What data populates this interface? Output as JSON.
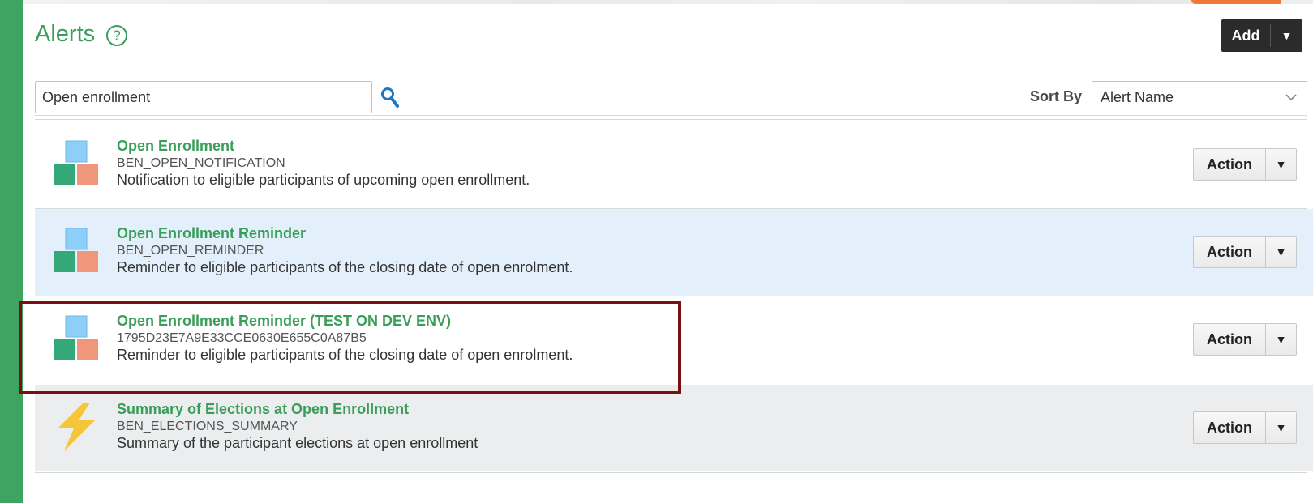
{
  "header": {
    "title": "Alerts",
    "help_glyph": "?",
    "add_label": "Add",
    "add_caret": "▼"
  },
  "search": {
    "value": "Open enrollment",
    "placeholder": ""
  },
  "sort": {
    "label": "Sort By",
    "value": "Alert Name"
  },
  "colors": {
    "accent_green": "#3a9e5a",
    "selected_row_bg": "#e3f0fb",
    "alt_row_bg": "#ebedee",
    "highlight_border": "#7a0f0f"
  },
  "alerts": [
    {
      "name": "Open Enrollment",
      "code": "BEN_OPEN_NOTIFICATION",
      "description": "Notification to eligible participants of upcoming open enrollment.",
      "icon": "blocks-icon",
      "action_label": "Action",
      "action_caret": "▼"
    },
    {
      "name": "Open Enrollment Reminder",
      "code": "BEN_OPEN_REMINDER",
      "description": "Reminder to eligible participants of the closing date of open enrolment.",
      "icon": "blocks-icon",
      "action_label": "Action",
      "action_caret": "▼"
    },
    {
      "name": "Open Enrollment Reminder (TEST ON DEV ENV)",
      "code": "1795D23E7A9E33CCE0630E655C0A87B5",
      "description": "Reminder to eligible participants of the closing date of open enrolment.",
      "icon": "blocks-icon",
      "action_label": "Action",
      "action_caret": "▼"
    },
    {
      "name": "Summary of Elections at Open Enrollment",
      "code": "BEN_ELECTIONS_SUMMARY",
      "description": "Summary of the participant elections at open enrollment",
      "icon": "lightning-bolt-icon",
      "action_label": "Action",
      "action_caret": "▼"
    }
  ]
}
